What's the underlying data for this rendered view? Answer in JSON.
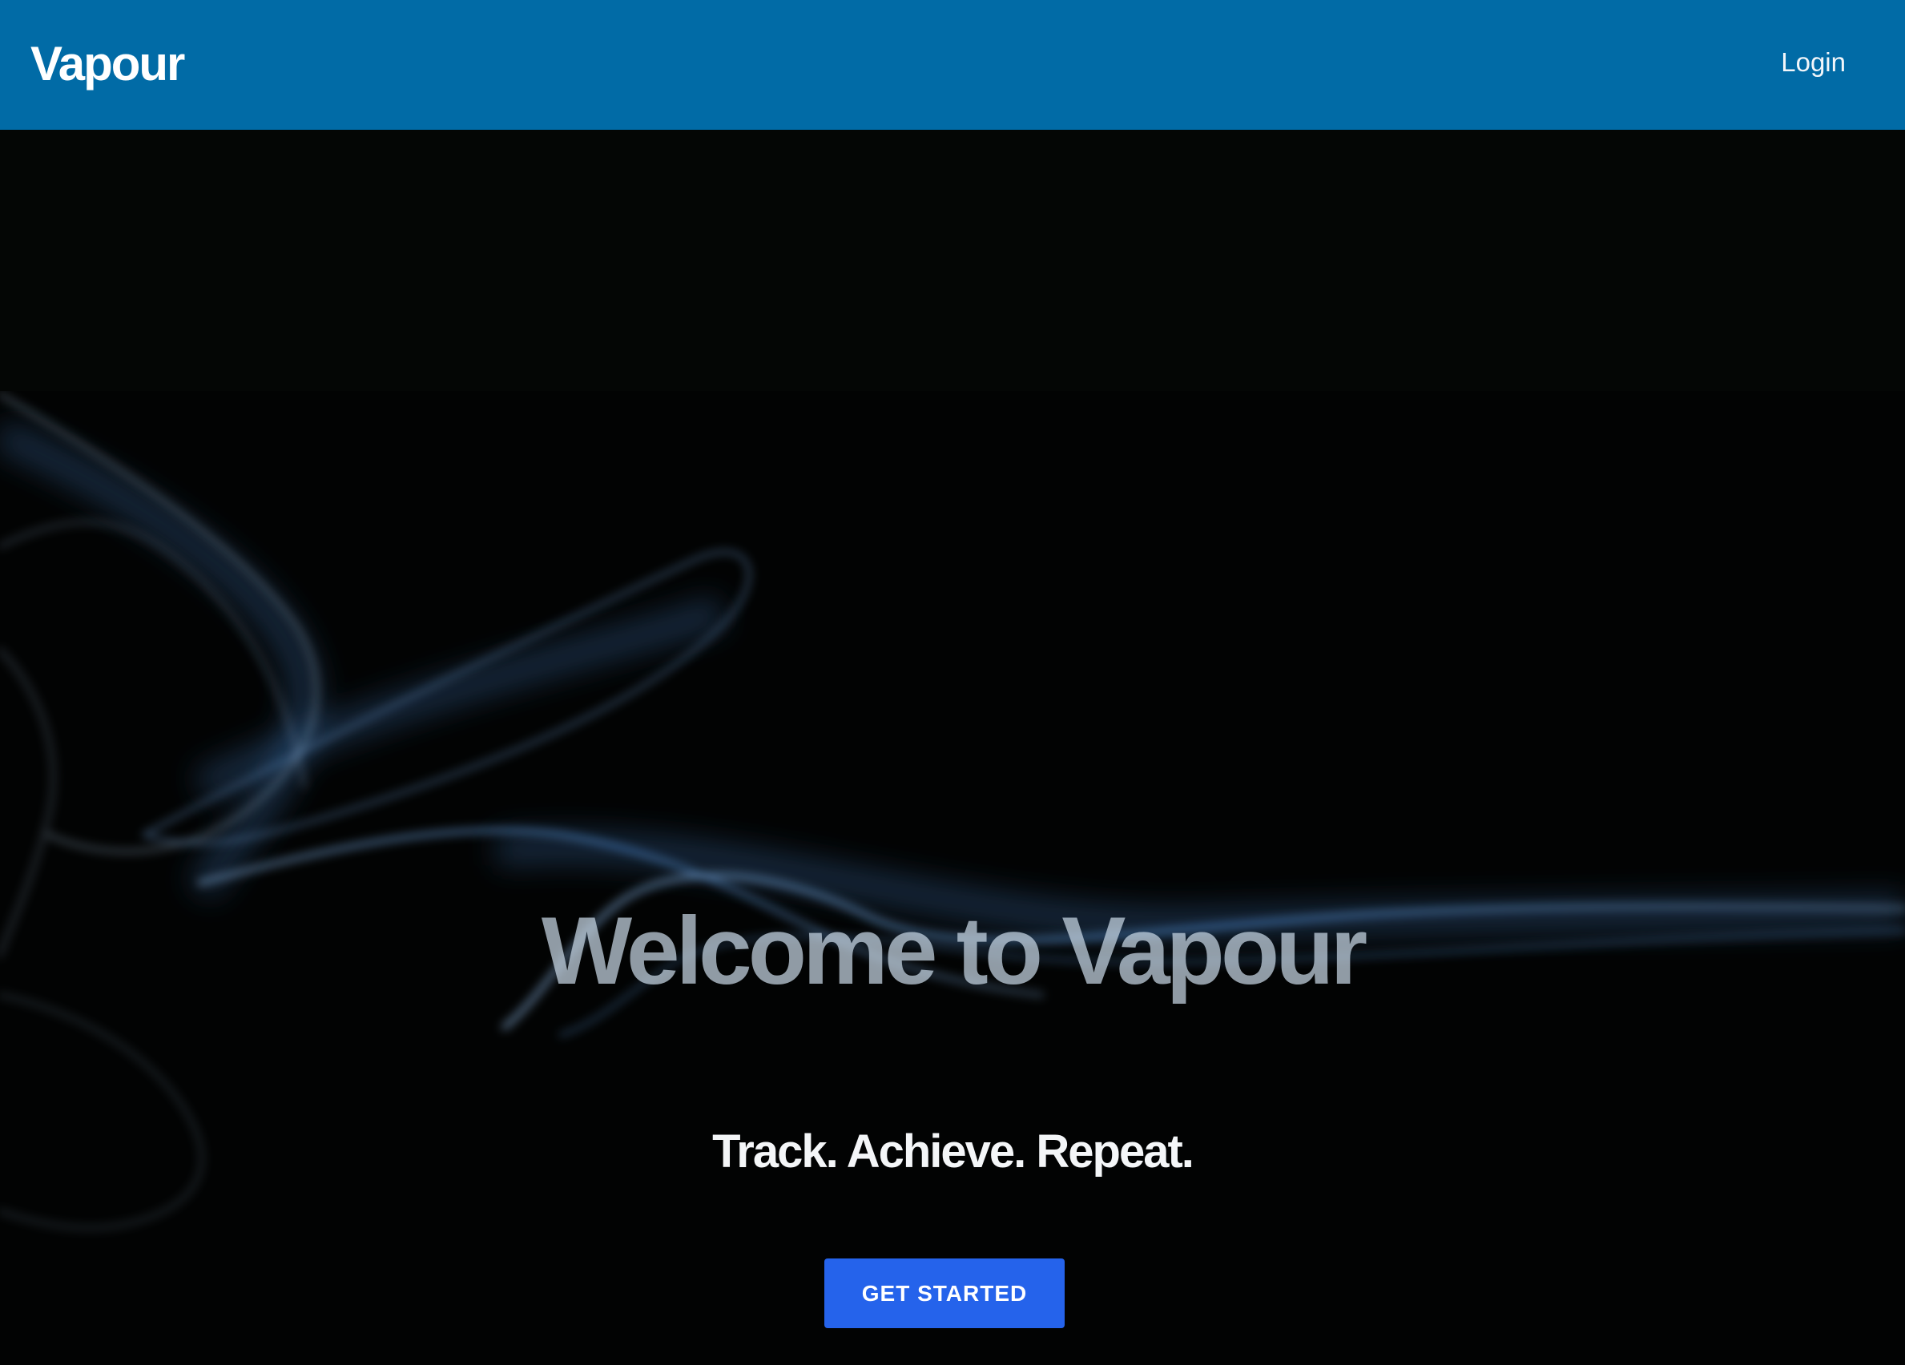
{
  "navbar": {
    "brand": "Vapour",
    "login_label": "Login",
    "background_color": "#016ba6"
  },
  "hero": {
    "headline": "Welcome to Vapour",
    "tagline": "Track. Achieve. Repeat.",
    "cta_label": "GET STARTED",
    "cta_color": "#2563eb",
    "background_image": "blue smoke on black background"
  }
}
